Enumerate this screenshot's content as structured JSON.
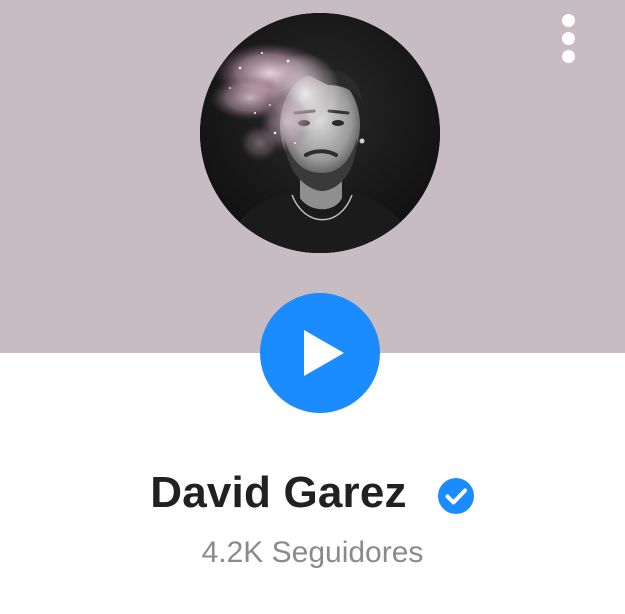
{
  "profile": {
    "name": "David Garez",
    "followers_label": "4.2K Seguidores",
    "verified": true
  },
  "icons": {
    "more": "more-vertical-icon",
    "play": "play-icon",
    "verified": "verified-badge-icon"
  },
  "colors": {
    "header_background": "#c8bcc3",
    "accent": "#1a8cff",
    "name_text": "#212121",
    "secondary_text": "#8a8a8a"
  }
}
